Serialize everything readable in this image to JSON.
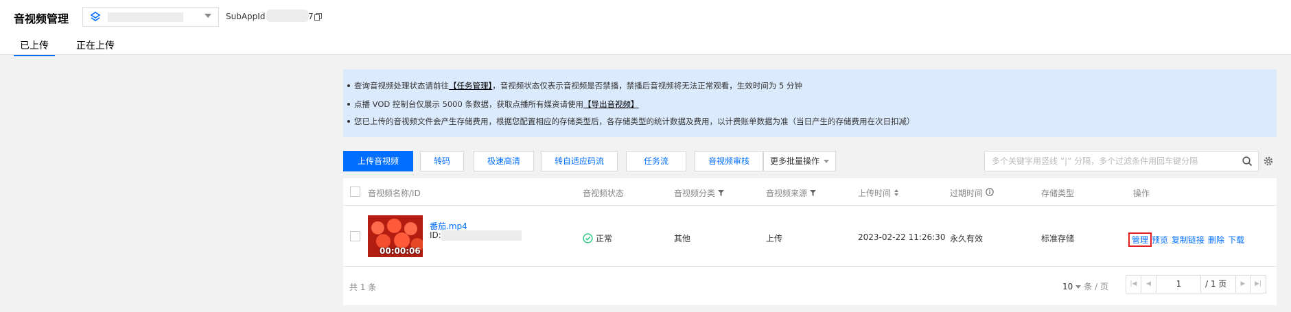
{
  "header": {
    "title": "音视频管理",
    "subapp_label": "SubAppId",
    "subapp_tail": "7"
  },
  "tabs": [
    {
      "label": "已上传",
      "active": true
    },
    {
      "label": "正在上传",
      "active": false
    }
  ],
  "notice": {
    "line1_pre": "查询音视频处理状态请前往",
    "line1_link": "【任务管理】",
    "line1_post": "，音视频状态仅表示音视频是否禁播，禁播后音视频将无法正常观看，生效时间为 5 分钟",
    "line2_pre": "点播 VOD 控制台仅展示 5000 条数据，获取点播所有媒资请使用",
    "line2_link": "【导出音视频】",
    "line3": "您已上传的音视频文件会产生存储费用，根据您配置相应的存储类型后，各存储类型的统计数据及费用，以计费账单数据为准（当日产生的存储费用在次日扣减）"
  },
  "toolbar": {
    "upload": "上传音视频",
    "transcode": "转码",
    "fast_hd": "极速高清",
    "adaptive": "转自适应码流",
    "taskflow": "任务流",
    "review": "音视频审核",
    "more": "更多批量操作",
    "search_placeholder": "多个关键字用竖线 “|” 分隔，多个过滤条件用回车键分隔"
  },
  "table": {
    "headers": {
      "name": "音视频名称/ID",
      "status": "音视频状态",
      "category": "音视频分类",
      "source": "音视频来源",
      "upload_time": "上传时间",
      "expire": "过期时间",
      "storage": "存储类型",
      "ops": "操作"
    },
    "rows": [
      {
        "filename": "番茄.mp4",
        "id_label": "ID:",
        "duration": "00:00:06",
        "status": "正常",
        "category": "其他",
        "source": "上传",
        "upload_time": "2023-02-22 11:26:30",
        "expire": "永久有效",
        "storage": "标准存储",
        "ops": {
          "manage": "管理",
          "preview": "预览",
          "copy": "复制链接",
          "delete": "删除",
          "download": "下载"
        }
      }
    ]
  },
  "footer": {
    "total": "共 1 条",
    "page_size": "10",
    "page_size_unit": "条 / 页",
    "current_page": "1",
    "total_pages": "/ 1 页"
  },
  "colors": {
    "accent": "#006eff",
    "notice_bg": "#dbeafd",
    "highlight": "#e02020",
    "ok": "#29cc85"
  }
}
